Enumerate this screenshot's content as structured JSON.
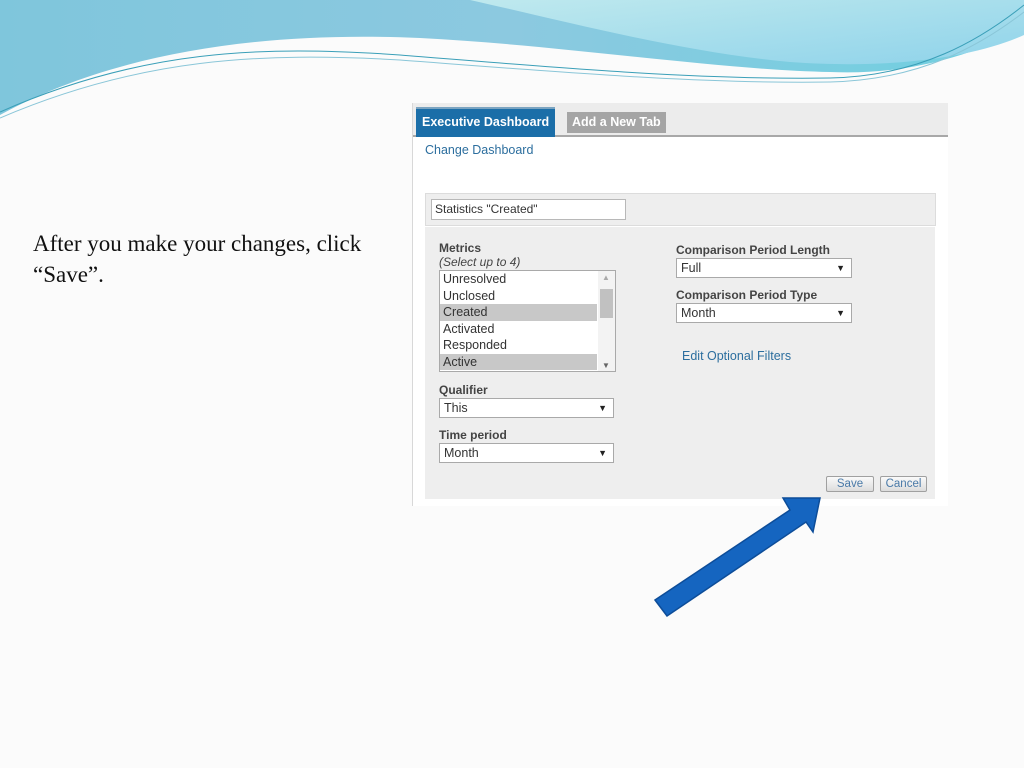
{
  "slide": {
    "instruction": "After you make your changes, click “Save”."
  },
  "tabs": [
    {
      "label": "Executive Dashboard",
      "active": true
    },
    {
      "label": "Add a New Tab",
      "active": false
    }
  ],
  "change_dashboard_link": "Change Dashboard",
  "dashboard_name": {
    "value": "Statistics \"Created\""
  },
  "metrics": {
    "label": "Metrics",
    "hint": "(Select up to 4)",
    "options": [
      {
        "label": "Unresolved",
        "selected": false
      },
      {
        "label": "Unclosed",
        "selected": false
      },
      {
        "label": "Created",
        "selected": true
      },
      {
        "label": "Activated",
        "selected": false
      },
      {
        "label": "Responded",
        "selected": false
      },
      {
        "label": "Active",
        "selected": true
      }
    ],
    "scroll_up_icon": "triangle-up-icon",
    "scroll_down_icon": "triangle-down-icon"
  },
  "qualifier": {
    "label": "Qualifier",
    "value": "This"
  },
  "time_period": {
    "label": "Time period",
    "value": "Month"
  },
  "comparison_period_length": {
    "label": "Comparison Period Length",
    "value": "Full"
  },
  "comparison_period_type": {
    "label": "Comparison Period Type",
    "value": "Month"
  },
  "edit_filters_link": "Edit Optional Filters",
  "buttons": {
    "save": "Save",
    "cancel": "Cancel"
  },
  "select_arrow": "▼",
  "colors": {
    "tab_active": "#1b6ea8",
    "link": "#2c6e9e",
    "arrow": "#1565c0"
  }
}
